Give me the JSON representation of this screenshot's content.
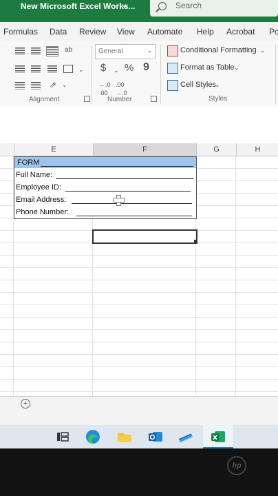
{
  "titlebar": {
    "workbook_title": "New Microsoft Excel Works...",
    "search_placeholder": "Search"
  },
  "menu": [
    "Formulas",
    "Data",
    "Review",
    "View",
    "Automate",
    "Help",
    "Acrobat",
    "Po"
  ],
  "ribbon": {
    "alignment_label": "Alignment",
    "number_label": "Number",
    "styles_label": "Styles",
    "number_format": "General",
    "currency_symbol": "$",
    "percent_symbol": "%",
    "comma_symbol": "9",
    "conditional_formatting": "Conditional Formatting",
    "format_as_table": "Format as Table",
    "cell_styles": "Cell Styles"
  },
  "columns": [
    "E",
    "F",
    "G",
    "H"
  ],
  "form": {
    "header": "FORM",
    "rows": [
      "Full Name:",
      "Employee ID:",
      "Email Address:",
      "Phone Number:"
    ]
  },
  "sheetbar": {
    "add_sheet": "+"
  },
  "device": {
    "brand": "hp"
  },
  "colors": {
    "excel_green": "#1e7b3f",
    "form_header": "#9ec4ea"
  }
}
